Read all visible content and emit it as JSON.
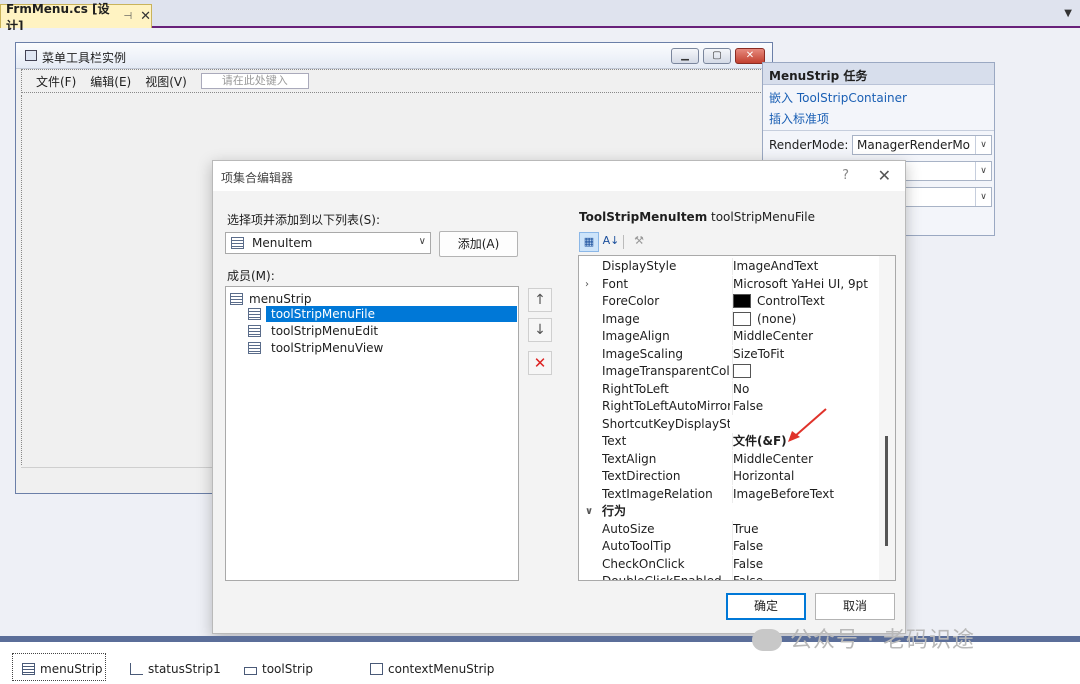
{
  "tab": {
    "title": "FrmMenu.cs [设计]",
    "pin": "⊣",
    "close": "✕"
  },
  "form": {
    "title": "菜单工具栏实例",
    "menu": [
      "文件(F)",
      "编辑(E)",
      "视图(V)"
    ],
    "type_here": "请在此处键入"
  },
  "tasks": {
    "header": "MenuStrip 任务",
    "link_embed": "嵌入 ToolStripContainer",
    "link_insert": "插入标准项",
    "render_label": "RenderMode:",
    "render_value": "ManagerRenderMo"
  },
  "dialog": {
    "title": "项集合编辑器",
    "help": "?",
    "select_label": "选择项并添加到以下列表(S):",
    "type_value": "MenuItem",
    "add_label": "添加(A)",
    "members_label": "成员(M):",
    "tree": {
      "root": "menuStrip",
      "children": [
        "toolStripMenuFile",
        "toolStripMenuEdit",
        "toolStripMenuView"
      ]
    },
    "up": "↑",
    "down": "↓",
    "delete": "✕",
    "pg_type": "ToolStripMenuItem",
    "pg_name": "toolStripMenuFile",
    "properties": [
      {
        "name": "DisplayStyle",
        "value": "ImageAndText"
      },
      {
        "name": "Font",
        "value": "Microsoft YaHei UI, 9pt",
        "expand": "›"
      },
      {
        "name": "ForeColor",
        "value": "ControlText",
        "swatch": "#000000"
      },
      {
        "name": "Image",
        "value": "(none)",
        "swatch": "#ffffff"
      },
      {
        "name": "ImageAlign",
        "value": "MiddleCenter"
      },
      {
        "name": "ImageScaling",
        "value": "SizeToFit"
      },
      {
        "name": "ImageTransparentColo",
        "value": "",
        "swatch": "#ffffff"
      },
      {
        "name": "RightToLeft",
        "value": "No"
      },
      {
        "name": "RightToLeftAutoMirrorI",
        "value": "False"
      },
      {
        "name": "ShortcutKeyDisplayStrir",
        "value": ""
      },
      {
        "name": "Text",
        "value": "文件(&F)",
        "bold": true
      },
      {
        "name": "TextAlign",
        "value": "MiddleCenter"
      },
      {
        "name": "TextDirection",
        "value": "Horizontal"
      },
      {
        "name": "TextImageRelation",
        "value": "ImageBeforeText"
      },
      {
        "name": "行为",
        "value": "",
        "category": true,
        "expand": "∨"
      },
      {
        "name": "AutoSize",
        "value": "True"
      },
      {
        "name": "AutoToolTip",
        "value": "False"
      },
      {
        "name": "CheckOnClick",
        "value": "False"
      },
      {
        "name": "DoubleClickEnabled",
        "value": "False"
      }
    ],
    "ok_label": "确定",
    "cancel_label": "取消"
  },
  "tray": [
    "menuStrip",
    "statusStrip1",
    "toolStrip",
    "contextMenuStrip"
  ],
  "watermark": "公众号 · 老码识途",
  "colors": {
    "accent": "#0078d7",
    "annotation": "#e0322a",
    "tray_border": "#5b6e99"
  }
}
